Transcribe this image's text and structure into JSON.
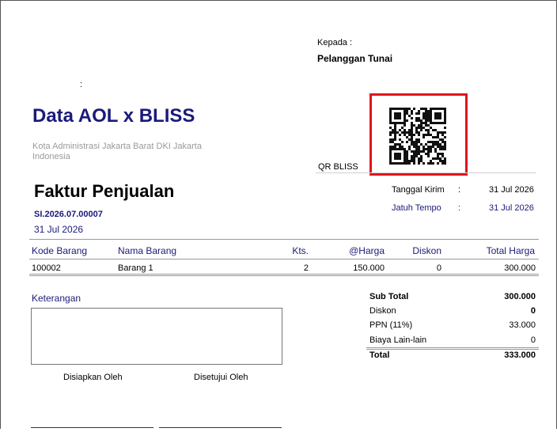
{
  "recipient": {
    "label": "Kepada :",
    "name": "Pelanggan Tunai"
  },
  "colon_marker": ":",
  "company": {
    "name": "Data AOL x BLISS",
    "address_line1": "Kota Administrasi Jakarta Barat DKI Jakarta",
    "address_line2": "Indonesia"
  },
  "qr": {
    "caption": "QR BLISS"
  },
  "invoice": {
    "title": "Faktur Penjualan",
    "number": "SI.2026.07.00007",
    "date": "31 Jul 2026",
    "ship_date_label": "Tanggal Kirim",
    "ship_date": "31 Jul 2026",
    "due_date_label": "Jatuh Tempo",
    "due_date": "31 Jul 2026",
    "colon": ":"
  },
  "table": {
    "headers": {
      "code": "Kode Barang",
      "name": "Nama Barang",
      "qty": "Kts.",
      "price": "@Harga",
      "discount": "Diskon",
      "total": "Total Harga"
    },
    "rows": [
      {
        "code": "100002",
        "name": "Barang 1",
        "qty": "2",
        "price": "150.000",
        "discount": "0",
        "total": "300.000"
      }
    ]
  },
  "notes": {
    "label": "Keterangan"
  },
  "summary": {
    "subtotal_label": "Sub Total",
    "subtotal": "300.000",
    "discount_label": "Diskon",
    "discount": "0",
    "tax_label": "PPN (11%)",
    "tax": "33.000",
    "other_label": "Biaya Lain-lain",
    "other": "0",
    "total_label": "Total",
    "total": "333.000"
  },
  "signatures": {
    "prepared": "Disiapkan Oleh",
    "approved": "Disetujui Oleh"
  },
  "colors": {
    "accent_navy": "#1a1a7a",
    "highlight_red": "#e0141e"
  }
}
